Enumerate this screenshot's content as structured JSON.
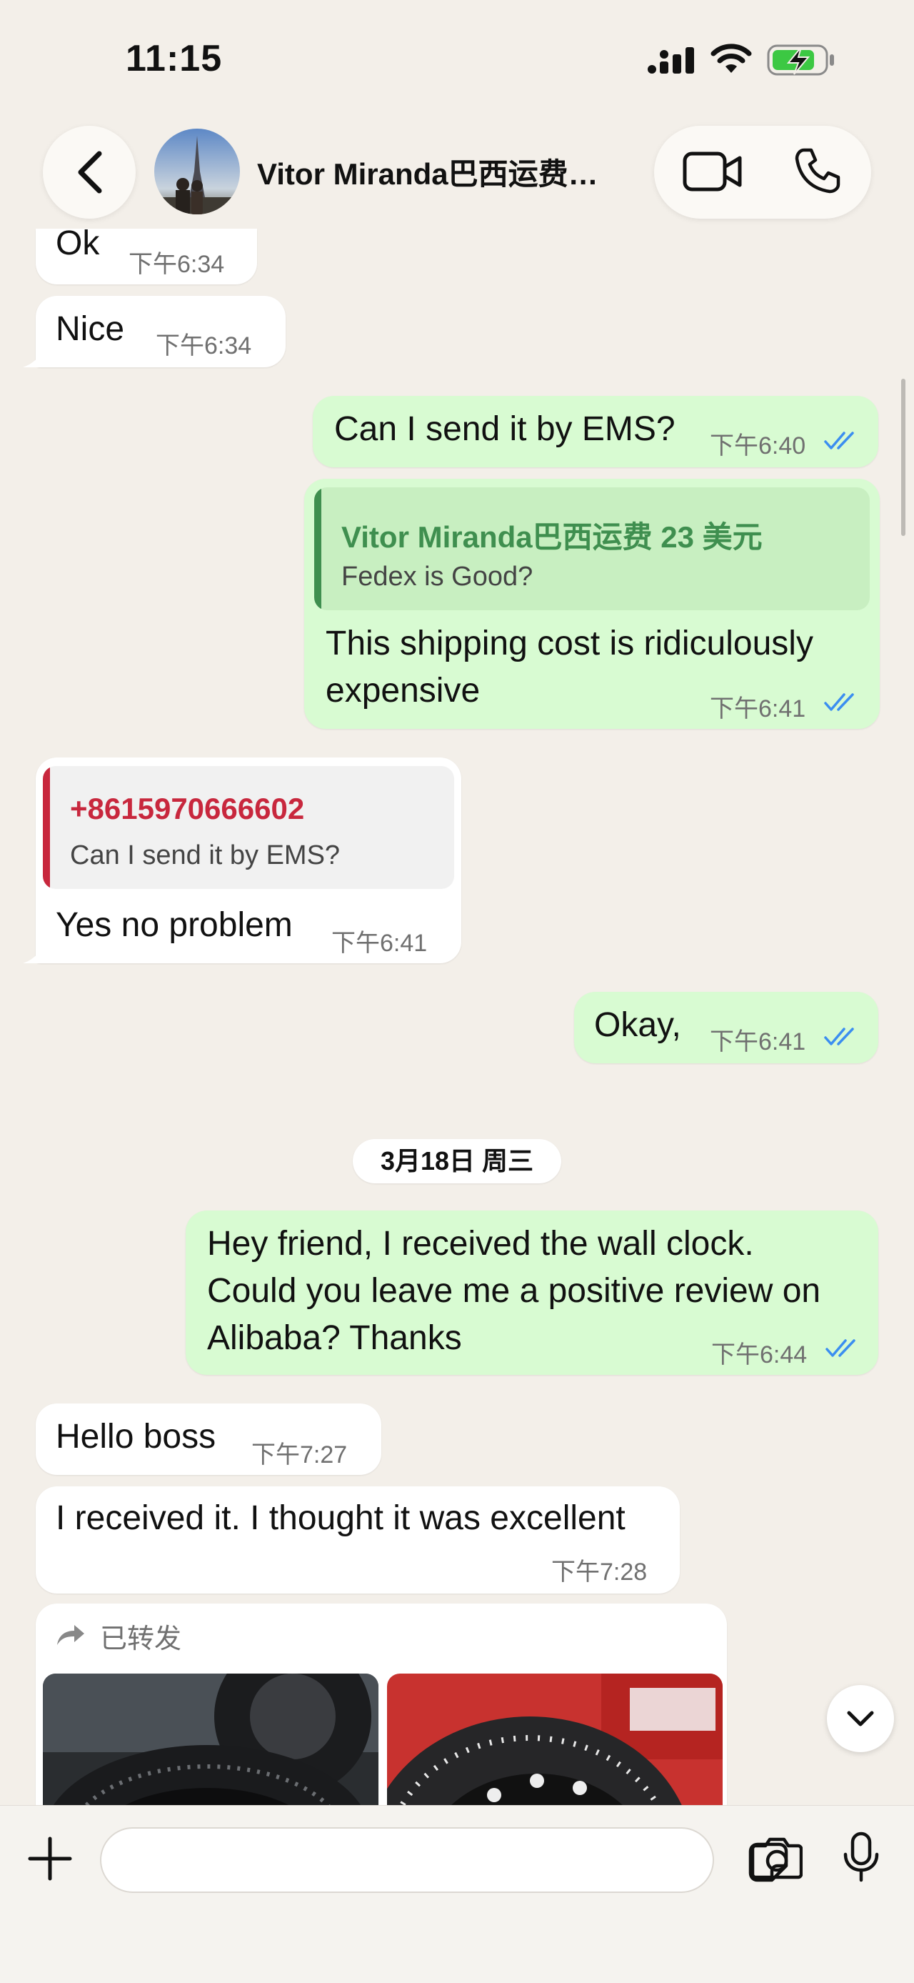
{
  "status_bar": {
    "time": "11:15"
  },
  "header": {
    "contact_name": "Vitor Miranda巴西运费…"
  },
  "messages": [
    {
      "dir": "in",
      "text": "Ok",
      "time": "下午6:34"
    },
    {
      "dir": "in",
      "text": "Nice",
      "time": "下午6:34"
    },
    {
      "dir": "out",
      "text": "Can I send it by EMS?",
      "time": "下午6:40"
    },
    {
      "dir": "out",
      "quote_name": "Vitor Miranda巴西运费 23 美元",
      "quote_text": "Fedex is Good?",
      "lines": [
        "This shipping cost is ridiculously",
        "expensive"
      ],
      "time": "下午6:41"
    },
    {
      "dir": "in",
      "quote_name": "+8615970666602",
      "quote_text": "Can I send it by EMS?",
      "text": "Yes no problem",
      "time": "下午6:41"
    },
    {
      "dir": "out",
      "text": "Okay,",
      "time": "下午6:41"
    },
    {
      "dir": "out",
      "lines": [
        "Hey friend, I received the wall clock.",
        "Could you leave me a positive review on",
        "Alibaba? Thanks"
      ],
      "time": "下午6:44"
    },
    {
      "dir": "in",
      "text": "Hello boss",
      "time": "下午7:27"
    },
    {
      "dir": "in",
      "text": "I received it. I thought it was excellent",
      "time": "下午7:28"
    },
    {
      "dir": "in",
      "forwarded_label": "已转发"
    }
  ],
  "date_separator": "3月18日 周三",
  "colors": {
    "background": "#f3efe9",
    "incoming_bubble": "#ffffff",
    "outgoing_bubble": "#d8fbd2",
    "read_ticks": "#3b8ef0",
    "quote_green": "#3f8f4f",
    "quote_red": "#c8273d"
  }
}
